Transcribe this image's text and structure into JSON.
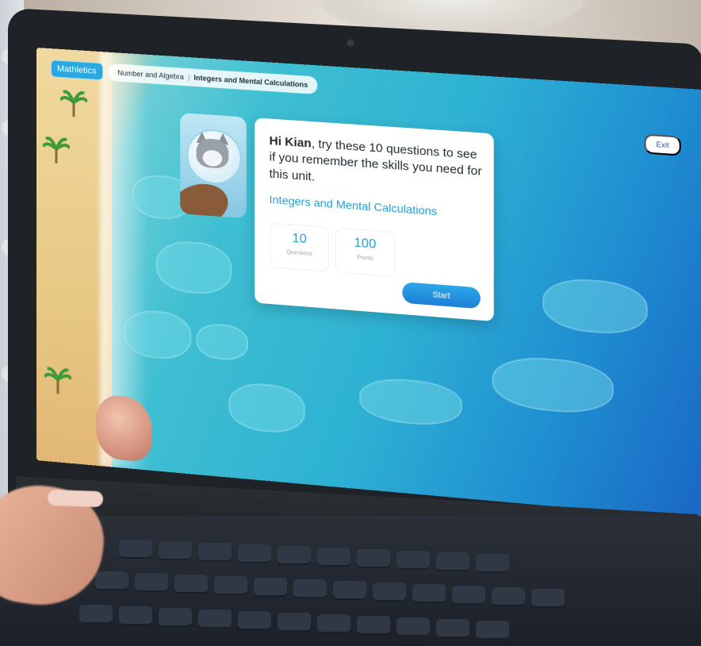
{
  "app": {
    "logo": "Mathletics"
  },
  "breadcrumb": {
    "section": "Number and Algebra",
    "separator": "|",
    "current": "Integers and Mental Calculations"
  },
  "header": {
    "exit_label": "Exit"
  },
  "intro": {
    "greeting_name": "Hi Kian",
    "greeting_text": ", try these 10 questions to see if you remember the skills you need for this unit.",
    "unit_title": "Integers and Mental Calculations",
    "stats": [
      {
        "value": "10",
        "label": "Questions"
      },
      {
        "value": "100",
        "label": "Points"
      }
    ],
    "start_label": "Start"
  },
  "colors": {
    "accent": "#1ea0da",
    "button": "#1f7fd6",
    "logo_bg": "#2aa8e0"
  },
  "icons": {
    "avatar": "astronaut-cat-avatar"
  }
}
